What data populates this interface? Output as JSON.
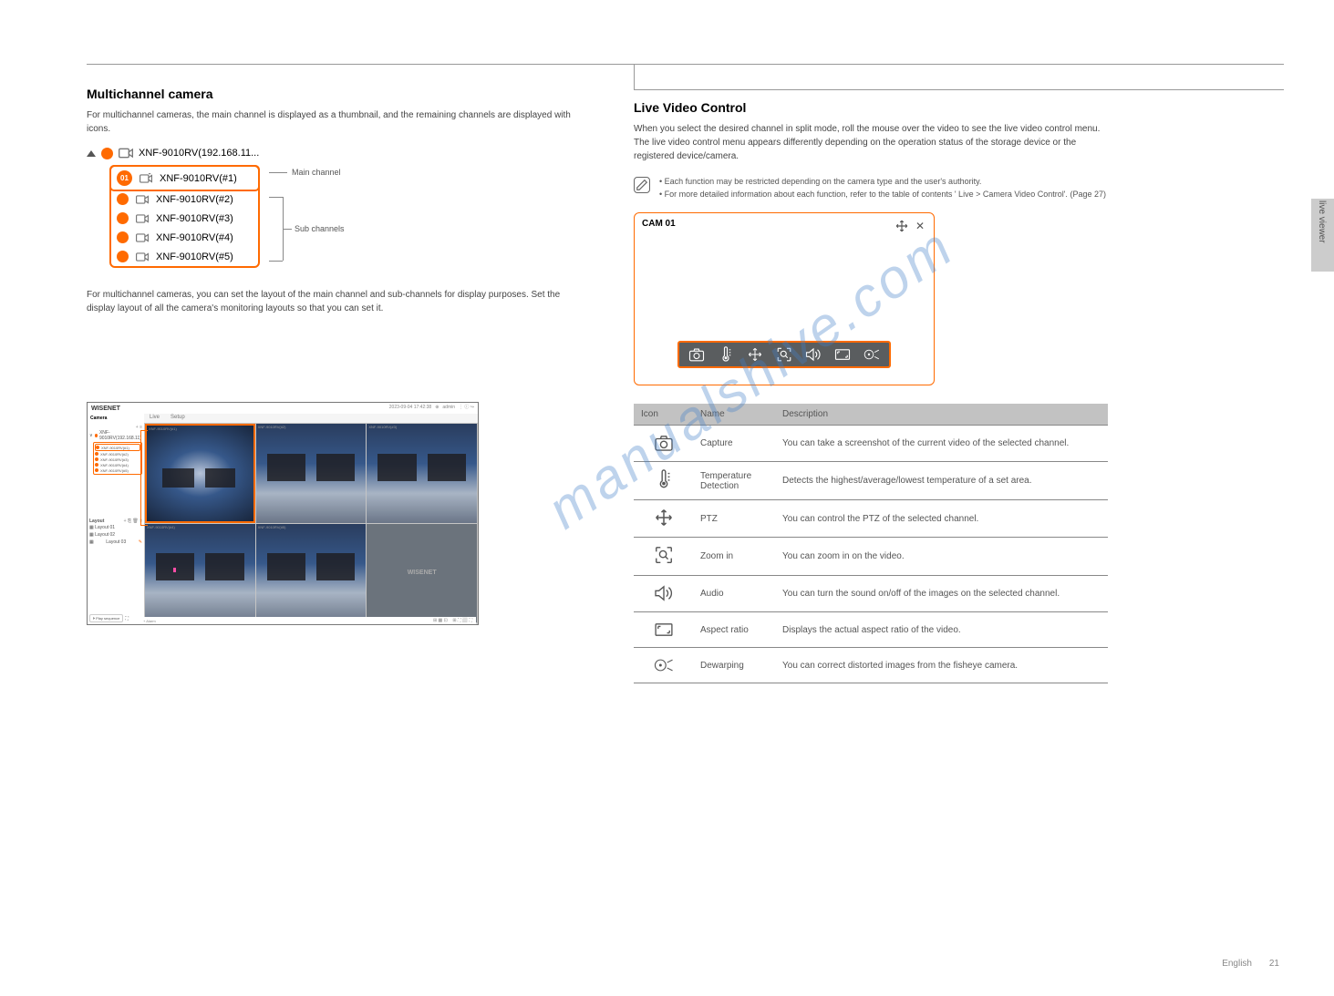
{
  "side_label": "live viewer",
  "page": {
    "number": "21",
    "lang": "English"
  },
  "watermark": "manualshive.com",
  "left": {
    "heading": "Multichannel camera",
    "desc": "For multichannel cameras, the main channel is displayed as a thumbnail, and the remaining channels are displayed with icons.",
    "tree": {
      "parent": "XNF-9010RV(192.168.11...",
      "children": [
        "XNF-9010RV(#1)",
        "XNF-9010RV(#2)",
        "XNF-9010RV(#3)",
        "XNF-9010RV(#4)",
        "XNF-9010RV(#5)"
      ],
      "label_main": "Main channel",
      "label_sub": "Sub channels"
    },
    "mid_desc": "For multichannel cameras, you can set the layout of the main channel and sub-channels for display purposes. Set the display layout of all the camera's monitoring layouts so that you can set it.",
    "software": {
      "logo": "WISENET",
      "tabs": [
        "Live",
        "Setup"
      ],
      "timestamp": "2023-09-04 17:42:38",
      "user": "admin",
      "sidebar_title": "Camera",
      "parent": "XNF-9010RV(192.168.11)",
      "items": [
        "XNF-9010RV(#1)",
        "XNF-9010RV(#2)",
        "XNF-9010RV(#3)",
        "XNF-9010RV(#4)",
        "XNF-9010RV(#5)"
      ],
      "layout_title": "Layout",
      "layouts": [
        "Layout 01",
        "Layout 02",
        "Layout 03"
      ],
      "play_seq": "Play sequence",
      "alarm": "Alarm",
      "empty": "WISENET"
    }
  },
  "right": {
    "heading": "Live Video Control",
    "desc": "When you select the desired channel in split mode, roll the mouse over the video to see the live video control menu. The live video control menu appears differently depending on the operation status of the storage device or the registered device/camera.",
    "note": "Each function may be restricted depending on the camera type and the user's authority.",
    "note2": "For more detailed information about each function, refer to the table of contents ' Live > Camera Video Control'.",
    "note_pg": "(Page 27)",
    "tile_title": "CAM 01",
    "table": {
      "head_icon": "Icon",
      "head_name": "Name",
      "head_desc": "Description",
      "rows": [
        {
          "name": "Capture",
          "desc": "You can take a screenshot of the current video of the selected channel."
        },
        {
          "name": "Temperature Detection",
          "desc": "Detects the highest/average/lowest temperature of a set area."
        },
        {
          "name": "PTZ",
          "desc": "You can control the PTZ of the selected channel."
        },
        {
          "name": "Zoom in",
          "desc": "You can zoom in on the video."
        },
        {
          "name": "Audio",
          "desc": "You can turn the sound on/off of the images on the selected channel."
        },
        {
          "name": "Aspect ratio",
          "desc": "Displays the actual aspect ratio of the video."
        },
        {
          "name": "Dewarping",
          "desc": "You can correct distorted images from the fisheye camera."
        }
      ]
    }
  }
}
